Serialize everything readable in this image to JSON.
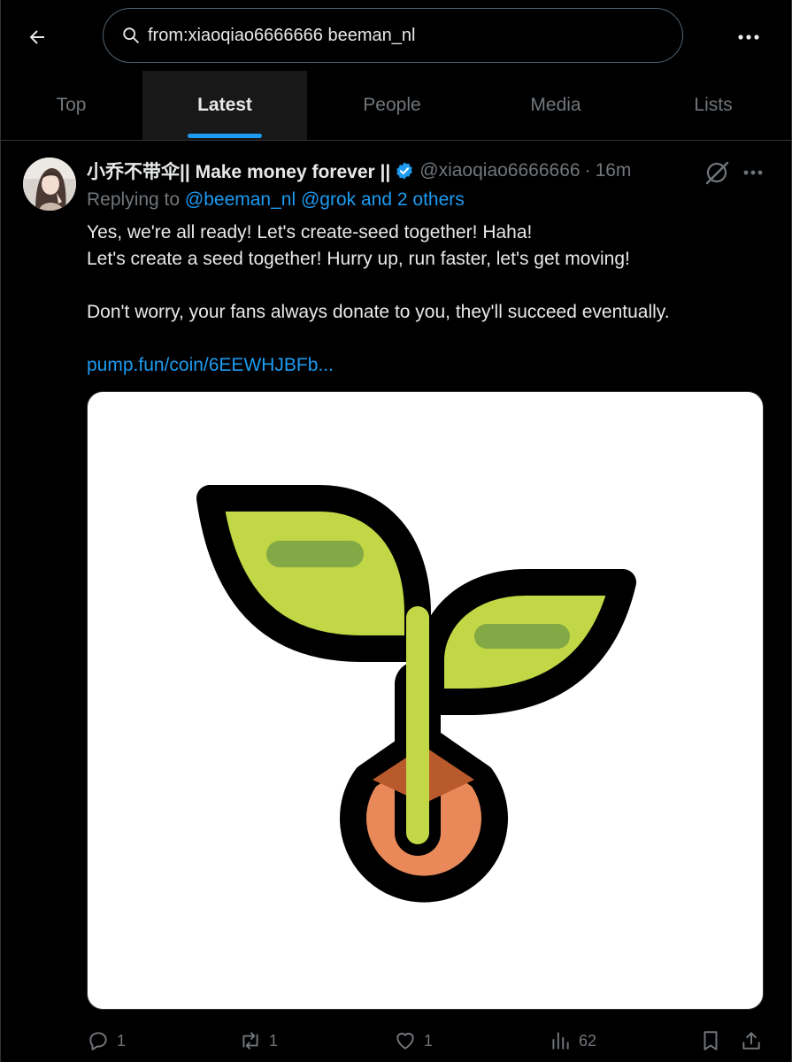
{
  "search": {
    "query": "from:xiaoqiao6666666 beeman_nl"
  },
  "tabs": [
    {
      "label": "Top"
    },
    {
      "label": "Latest"
    },
    {
      "label": "People"
    },
    {
      "label": "Media"
    },
    {
      "label": "Lists"
    }
  ],
  "active_tab": "Latest",
  "post": {
    "display_name": "小乔不带伞|| Make money forever ||",
    "handle": "@xiaoqiao6666666",
    "separator": "·",
    "time": "16m",
    "replying_prefix": "Replying to",
    "replying_users": [
      "@beeman_nl",
      "@grok",
      "and 2 others"
    ],
    "lines": [
      "Yes, we're all ready! Let's create-seed together! Haha!",
      "Let's create a seed together! Hurry up, run faster, let's get moving!",
      "Don't worry, your fans always donate to you, they'll succeed eventually."
    ],
    "link": "pump.fun/coin/6EEWHJBFb...",
    "media_icon": "seedling-emoji-icon",
    "stats": {
      "replies": "1",
      "reposts": "1",
      "likes": "1",
      "views": "62"
    }
  },
  "colors": {
    "background": "#000000",
    "accent": "#1d9bf0",
    "text_primary": "#e7e9ea",
    "text_secondary": "#71767b",
    "leaf_green": "#c2d745",
    "leaf_vein": "#83a846",
    "seed_orange": "#e9895a",
    "seed_dark": "#b85a2b"
  }
}
